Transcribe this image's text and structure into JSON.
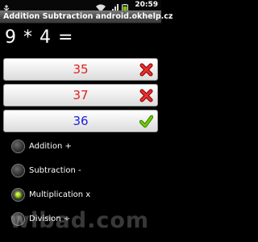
{
  "status_bar": {
    "time": "20:59",
    "icons": [
      "usb-icon",
      "wifi-icon",
      "signal-icon",
      "battery-icon"
    ]
  },
  "app": {
    "title": "Addition Subtraction android.okhelp.cz"
  },
  "problem": {
    "text": "9 * 4 ="
  },
  "answers": [
    {
      "value": "35",
      "color": "#e02020",
      "state": "wrong",
      "icon": "cross-icon"
    },
    {
      "value": "37",
      "color": "#e02020",
      "state": "wrong",
      "icon": "cross-icon"
    },
    {
      "value": "36",
      "color": "#2020e0",
      "state": "correct",
      "icon": "check-icon"
    }
  ],
  "operations": [
    {
      "label": "Addition +",
      "selected": false
    },
    {
      "label": "Subtraction -",
      "selected": false
    },
    {
      "label": "Multiplication x",
      "selected": true
    },
    {
      "label": "Division ÷",
      "selected": false
    }
  ],
  "watermark": "wlbad.com",
  "colors": {
    "wrong": "#e02020",
    "correct": "#2020e0",
    "check": "#5cb800",
    "radio_selected": "#9ee600"
  }
}
